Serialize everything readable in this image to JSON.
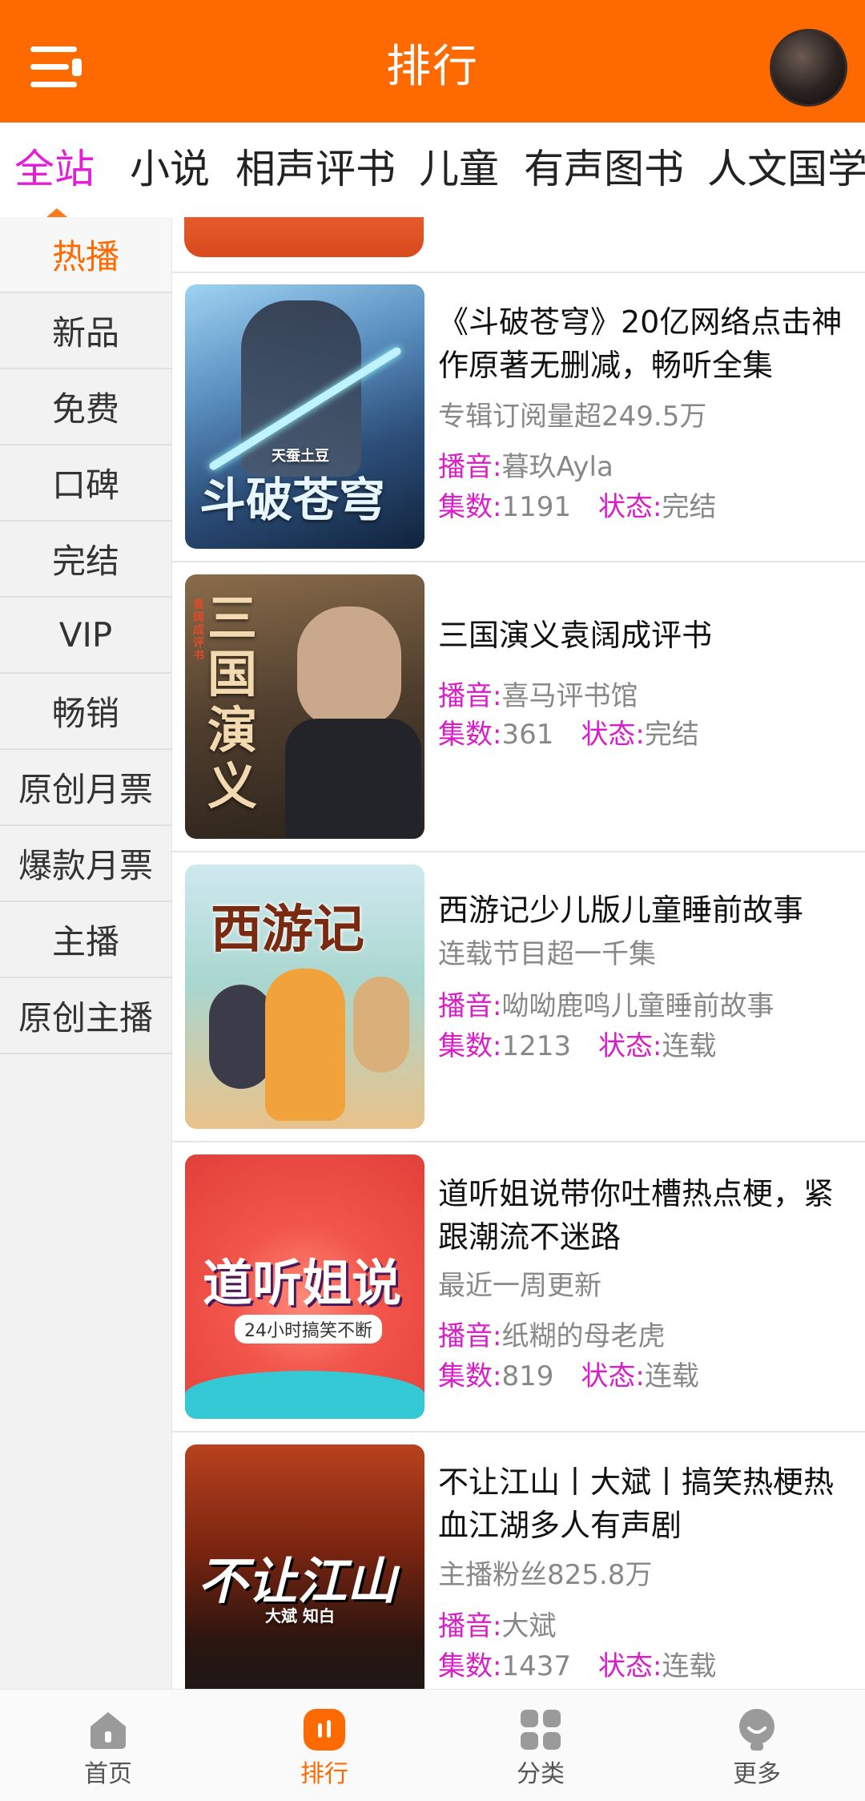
{
  "header": {
    "title": "排行",
    "menu_icon": "menu-icon",
    "avatar_icon": "user-avatar"
  },
  "categories": [
    "全站",
    "小说",
    "相声评书",
    "儿童",
    "有声图书",
    "人文国学"
  ],
  "active_category": "全站",
  "sidebar": [
    "热播",
    "新品",
    "免费",
    "口碑",
    "完结",
    "VIP",
    "畅销",
    "原创月票",
    "爆款月票",
    "主播",
    "原创主播"
  ],
  "active_sidebar": "热播",
  "labels": {
    "anchor": "播音",
    "episodes": "集数",
    "status": "状态",
    "colon": ":"
  },
  "items": [
    {
      "title": "《斗破苍穹》20亿网络点击神作原著无删减，畅听全集",
      "subtitle": "专辑订阅量超249.5万",
      "anchor": "暮玖Ayla",
      "episodes": "1191",
      "status": "完结",
      "cover_text": "斗破苍穹",
      "cover_small": "天蚕土豆"
    },
    {
      "title": "三国演义袁阔成评书",
      "subtitle": "",
      "anchor": "喜马评书馆",
      "episodes": "361",
      "status": "完结",
      "cover_text": "三国演义",
      "cover_small": "袁阔成评书"
    },
    {
      "title": "西游记少儿版儿童睡前故事",
      "subtitle": "连载节目超一千集",
      "anchor": "呦呦鹿鸣儿童睡前故事",
      "episodes": "1213",
      "status": "连载",
      "cover_text": "西游记",
      "cover_small": ""
    },
    {
      "title": "道听姐说带你吐槽热点梗，紧跟潮流不迷路",
      "subtitle": "最近一周更新",
      "anchor": "纸糊的母老虎",
      "episodes": "819",
      "status": "连载",
      "cover_text": "道听姐说",
      "cover_small": "24小时搞笑不断"
    },
    {
      "title": "不让江山丨大斌丨搞笑热梗热血江湖多人有声剧",
      "subtitle": "主播粉丝825.8万",
      "anchor": "大斌",
      "episodes": "1437",
      "status": "连载",
      "cover_text": "不让江山",
      "cover_small": "大斌  知白"
    }
  ],
  "bottom_nav": [
    {
      "label": "首页",
      "icon": "home-icon"
    },
    {
      "label": "排行",
      "icon": "ranking-icon"
    },
    {
      "label": "分类",
      "icon": "category-grid-icon"
    },
    {
      "label": "更多",
      "icon": "more-icon"
    }
  ],
  "colors": {
    "brand": "#ff6a00",
    "accent": "#d91ec8",
    "active_tab": "#e21ed6"
  }
}
